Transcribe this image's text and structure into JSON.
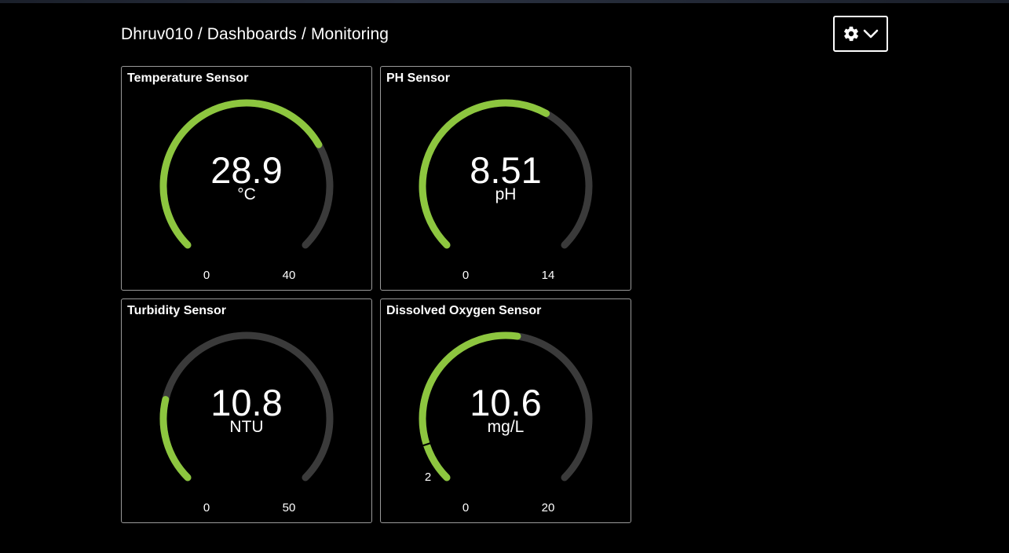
{
  "breadcrumb": {
    "user": "Dhruv010",
    "section": "Dashboards",
    "page": "Monitoring",
    "separator": "/"
  },
  "settings": {
    "icon": "gear-icon",
    "dropdown_icon": "chevron-down-icon"
  },
  "colors": {
    "background": "#000000",
    "gauge_fill": "#8dc63f",
    "gauge_track": "#3a3a3a",
    "tile_border": "#9a9a9a"
  },
  "tiles": [
    {
      "title": "Temperature Sensor",
      "value": "28.9",
      "unit": "°C",
      "min": "0",
      "max": "40",
      "fraction": 0.7225
    },
    {
      "title": "PH Sensor",
      "value": "8.51",
      "unit": "pH",
      "min": "0",
      "max": "14",
      "fraction": 0.6079
    },
    {
      "title": "Turbidity Sensor",
      "value": "10.8",
      "unit": "NTU",
      "min": "0",
      "max": "50",
      "fraction": 0.216
    },
    {
      "title": "Dissolved Oxygen Sensor",
      "value": "10.6",
      "unit": "mg/L",
      "min": "0",
      "max": "20",
      "fraction": 0.53,
      "threshold": "2",
      "threshold_fraction": 0.1
    }
  ]
}
